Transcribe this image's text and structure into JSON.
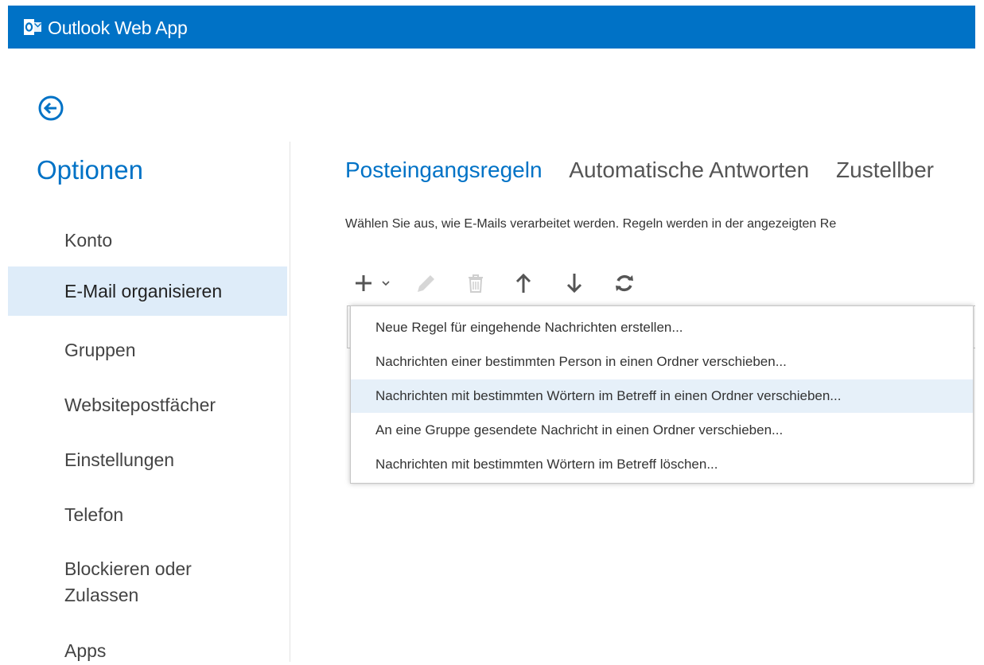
{
  "app": {
    "title": "Outlook Web App",
    "accent": "#0072c6",
    "logo_icon": "outlook-logo-icon"
  },
  "back": {
    "icon": "back-arrow-circle-icon"
  },
  "sidebar": {
    "title": "Optionen",
    "items": [
      {
        "label": "Konto",
        "selected": false
      },
      {
        "label": "E-Mail organisieren",
        "selected": true
      },
      {
        "label": "Gruppen",
        "selected": false
      },
      {
        "label": "Websitepostfächer",
        "selected": false
      },
      {
        "label": "Einstellungen",
        "selected": false
      },
      {
        "label": "Telefon",
        "selected": false
      },
      {
        "label": "Blockieren oder",
        "label2": "Zulassen",
        "selected": false
      },
      {
        "label": "Apps",
        "selected": false
      }
    ],
    "selected_bg": "#deecf9"
  },
  "main": {
    "tabs": [
      {
        "label": "Posteingangsregeln",
        "active": true
      },
      {
        "label": "Automatische Antworten",
        "active": false
      },
      {
        "label": "Zustellber",
        "active": false
      }
    ],
    "description": "Wählen Sie aus, wie E-Mails verarbeitet werden. Regeln werden in der angezeigten Re",
    "toolbar": [
      {
        "name": "new-rule-button",
        "icon": "plus-dropdown-icon",
        "enabled": true
      },
      {
        "name": "edit-button",
        "icon": "pencil-icon",
        "enabled": false
      },
      {
        "name": "delete-button",
        "icon": "trash-icon",
        "enabled": false
      },
      {
        "name": "move-up-button",
        "icon": "arrow-up-icon",
        "enabled": true
      },
      {
        "name": "move-down-button",
        "icon": "arrow-down-icon",
        "enabled": true
      },
      {
        "name": "refresh-button",
        "icon": "refresh-icon",
        "enabled": true
      }
    ],
    "new_rule_menu": {
      "items": [
        "Neue Regel für eingehende Nachrichten erstellen...",
        "Nachrichten einer bestimmten Person in einen Ordner verschieben...",
        "Nachrichten mit bestimmten Wörtern im Betreff in einen Ordner verschieben...",
        "An eine Gruppe gesendete Nachricht in einen Ordner verschieben...",
        "Nachrichten mit bestimmten Wörtern im Betreff löschen..."
      ],
      "hover_index": 2,
      "hover_bg": "#e6f0f9"
    }
  }
}
